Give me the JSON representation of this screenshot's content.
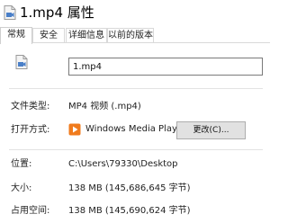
{
  "window": {
    "title": "1.mp4 属性",
    "title_icon": "video-file-icon"
  },
  "tabs": [
    {
      "label": "常规",
      "active": true
    },
    {
      "label": "安全",
      "active": false
    },
    {
      "label": "详细信息",
      "active": false
    },
    {
      "label": "以前的版本",
      "active": false
    }
  ],
  "general": {
    "file_name": "1.mp4",
    "file_icon": "video-file-icon",
    "type_label": "文件类型:",
    "type_value": "MP4 视频 (.mp4)",
    "open_with_label": "打开方式:",
    "open_with_app": "Windows Media Playe",
    "open_with_app_icon": "media-player-icon",
    "change_button": "更改(C)...",
    "location_label": "位置:",
    "location_value": "C:\\Users\\79330\\Desktop",
    "size_label": "大小:",
    "size_value": "138 MB (145,686,645 字节)",
    "size_on_disk_label": "占用空间:",
    "size_on_disk_value": "138 MB (145,690,624 字节)"
  },
  "colors": {
    "media_player_orange": "#f07b1d",
    "button_bg": "#e1e1e1",
    "input_border": "#7a7a7a"
  }
}
